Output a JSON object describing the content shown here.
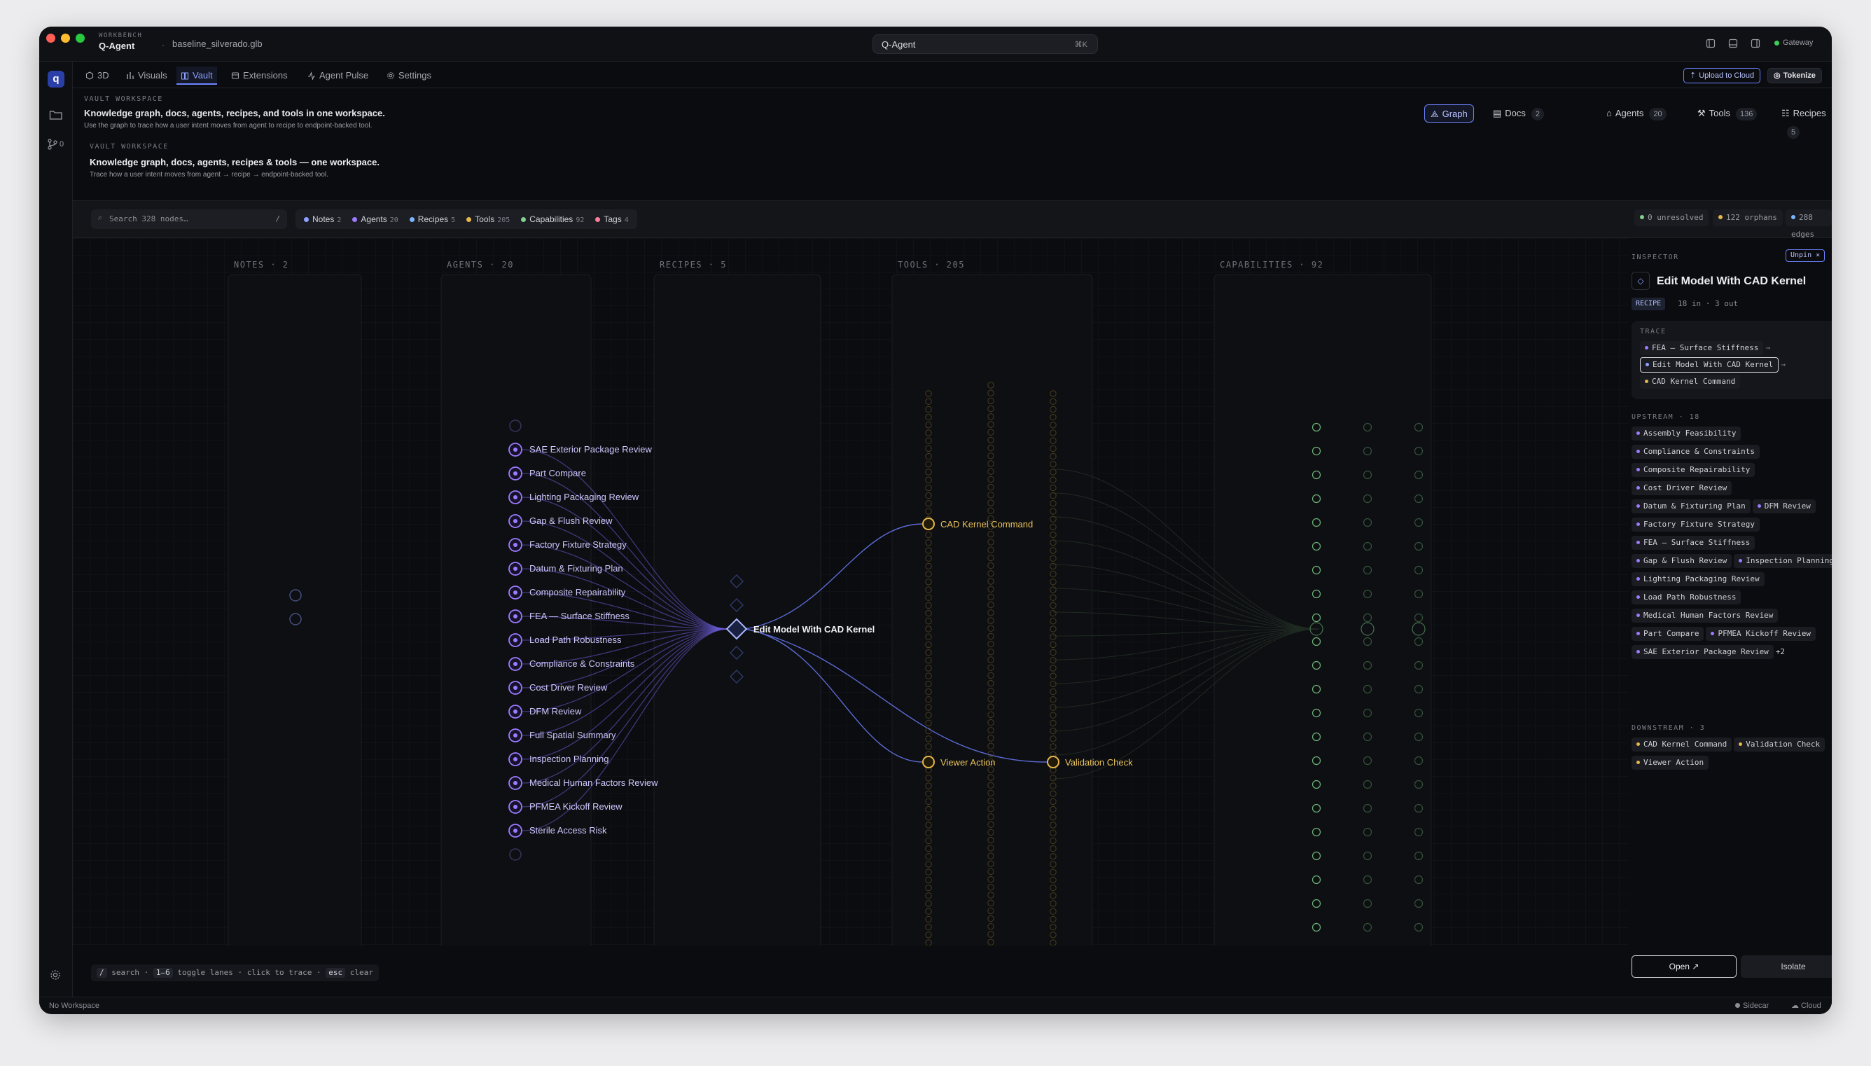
{
  "titlebar": {
    "eyebrow": "WORKBENCH",
    "app": "Q-Agent",
    "sep": "·",
    "file": "baseline_silverado.glb",
    "command": "Q-Agent",
    "shortcut": "⌘K",
    "gateway": "Gateway"
  },
  "sidebar": {
    "branch_count": "0"
  },
  "tabs": [
    {
      "label": "3D",
      "icon": "cube-icon"
    },
    {
      "label": "Visuals",
      "icon": "bar-chart-icon"
    },
    {
      "label": "Vault",
      "icon": "book-icon"
    },
    {
      "label": "Extensions",
      "icon": "extensions-icon"
    },
    {
      "label": "Agent Pulse",
      "icon": "pulse-icon"
    },
    {
      "label": "Settings",
      "icon": "gear-icon"
    }
  ],
  "actions": {
    "upload": "Upload to Cloud",
    "tokenize": "Tokenize"
  },
  "header_a": {
    "eyebrow": "VAULT WORKSPACE",
    "title": "Knowledge graph, docs, agents, recipes, and tools in one workspace.",
    "subtitle": "Use the graph to trace how a user intent moves from agent to recipe to endpoint-backed tool."
  },
  "view_pills": [
    {
      "label": "Graph",
      "count": ""
    },
    {
      "label": "Docs",
      "count": "2"
    },
    {
      "label": "Agents",
      "count": "20"
    },
    {
      "label": "Tools",
      "count": "136"
    },
    {
      "label": "Recipes",
      "count": "5"
    }
  ],
  "header_b": {
    "eyebrow": "VAULT WORKSPACE",
    "title": "Knowledge graph, docs, agents, recipes & tools — one workspace.",
    "subtitle": "Trace how a user intent moves from agent → recipe → endpoint-backed tool."
  },
  "search": {
    "placeholder": "Search 328 nodes…",
    "shortcut": "/"
  },
  "filters": [
    {
      "label": "Notes",
      "count": "2",
      "color": "#8ea1ff"
    },
    {
      "label": "Agents",
      "count": "20",
      "color": "#9d7bff"
    },
    {
      "label": "Recipes",
      "count": "5",
      "color": "#7ab6ff"
    },
    {
      "label": "Tools",
      "count": "205",
      "color": "#e7b74a"
    },
    {
      "label": "Capabilities",
      "count": "92",
      "color": "#7fd18b"
    },
    {
      "label": "Tags",
      "count": "4",
      "color": "#ff7e9a"
    }
  ],
  "stats": [
    {
      "label": "0 unresolved",
      "color": "#7fd18b"
    },
    {
      "label": "122 orphans",
      "color": "#e7b74a"
    },
    {
      "label": "288 edges",
      "color": "#7ab6ff"
    }
  ],
  "lanes": [
    {
      "label": "NOTES · 2"
    },
    {
      "label": "AGENTS · 20"
    },
    {
      "label": "RECIPES · 5"
    },
    {
      "label": "TOOLS · 205"
    },
    {
      "label": "CAPABILITIES · 92"
    }
  ],
  "graph": {
    "agents": [
      "SAE Exterior Package Review",
      "Part Compare",
      "Lighting Packaging Review",
      "Gap & Flush Review",
      "Factory Fixture Strategy",
      "Datum & Fixturing Plan",
      "Composite Repairability",
      "FEA — Surface Stiffness",
      "Load Path Robustness",
      "Compliance & Constraints",
      "Cost Driver Review",
      "DFM Review",
      "Full Spatial Summary",
      "Inspection Planning",
      "Medical Human Factors Review",
      "PFMEA Kickoff Review",
      "Sterile Access Risk"
    ],
    "recipe": "Edit Model With CAD Kernel",
    "tools": [
      "CAD Kernel Command",
      "Viewer Action",
      "Validation Check"
    ],
    "colors": {
      "agent": "#9d7bff",
      "recipe": "#8ea1ff",
      "tool": "#e7b74a",
      "capability": "#7fd18b",
      "note": "#6c7bc9"
    }
  },
  "inspector": {
    "eyebrow": "INSPECTOR",
    "unpin": "Unpin ×",
    "title": "Edit Model With CAD Kernel",
    "type": "RECIPE",
    "meta": "18 in · 3 out",
    "trace_label": "TRACE",
    "trace": [
      "FEA — Surface Stiffness",
      "Edit Model With CAD Kernel",
      "CAD Kernel Command"
    ],
    "arrow": "→",
    "upstream_label": "UPSTREAM · 18",
    "upstream": [
      "Assembly Feasibility",
      "Compliance & Constraints",
      "Composite Repairability",
      "Cost Driver Review",
      "Datum & Fixturing Plan",
      "DFM Review",
      "Factory Fixture Strategy",
      "FEA — Surface Stiffness",
      "Gap & Flush Review",
      "Inspection Planning",
      "Lighting Packaging Review",
      "Load Path Robustness",
      "Medical Human Factors Review",
      "Part Compare",
      "PFMEA Kickoff Review",
      "SAE Exterior Package Review"
    ],
    "more": "+2",
    "downstream_label": "DOWNSTREAM · 3",
    "downstream": [
      "CAD Kernel Command",
      "Validation Check",
      "Viewer Action"
    ],
    "open": "Open ↗",
    "isolate": "Isolate"
  },
  "hints": {
    "k1": "/",
    "t1": "search ·",
    "k2": "1–6",
    "t2": "toggle lanes · click to trace ·",
    "k3": "esc",
    "t3": "clear"
  },
  "footer": {
    "left": "No Workspace",
    "sidecar": "Sidecar",
    "cloud": "Cloud"
  }
}
